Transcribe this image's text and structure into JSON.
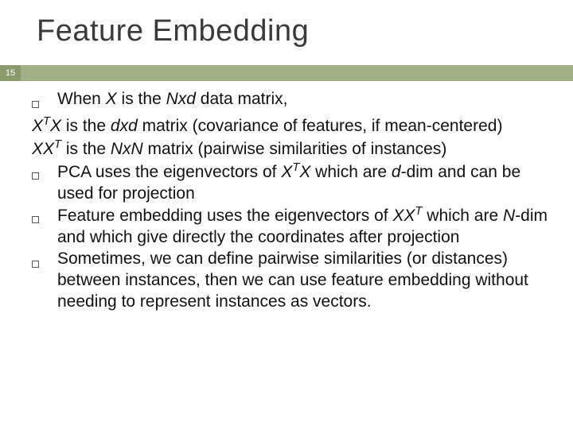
{
  "page_number": "15",
  "title": "Feature Embedding",
  "lines": {
    "l1_pre": "When ",
    "l1_x": "X",
    "l1_mid": " is the ",
    "l1_nxd": "Nxd",
    "l1_post": " data matrix,",
    "l2_x1": "X",
    "l2_t": "T",
    "l2_x2": "X",
    "l2_mid": " is the ",
    "l2_dxd": "dxd",
    "l2_post": " matrix (covariance of features, if mean-centered)",
    "l3_x1": "XX",
    "l3_t": "T",
    "l3_mid": " is the ",
    "l3_nxn": "NxN",
    "l3_post": " matrix (pairwise similarities of instances)",
    "l4_pre": "PCA uses the eigenvectors of ",
    "l4_x1": "X",
    "l4_t": "T",
    "l4_x2": "X",
    "l4_mid": " which are ",
    "l4_d": "d",
    "l4_post": "-dim and can be used for projection",
    "l5_pre": "Feature embedding uses the eigenvectors of ",
    "l5_x": "XX",
    "l5_t": "T",
    "l5_mid": " which are ",
    "l5_n": "N",
    "l5_post": "-dim and which give directly the coordinates after projection",
    "l6": "Sometimes, we can define pairwise similarities (or distances) between instances, then we can use feature embedding without needing to represent instances as vectors."
  }
}
